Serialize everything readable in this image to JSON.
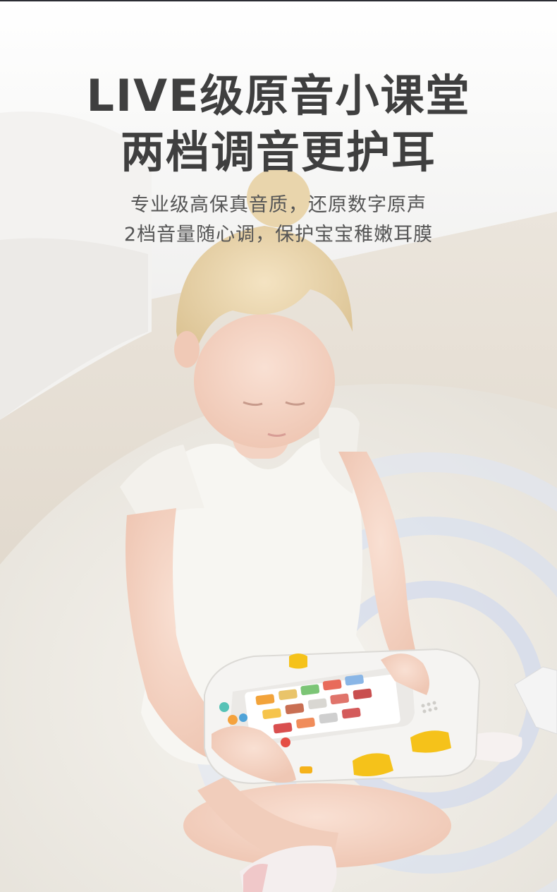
{
  "headline": {
    "line1": "LIVE级原音小课堂",
    "line2": "两档调音更护耳"
  },
  "subcopy": {
    "line1": "专业级高保真音质，还原数字原声",
    "line2": "2档音量随心调，保护宝宝稚嫩耳膜"
  },
  "colors": {
    "headline": "#3f3f3f",
    "subcopy": "#555555",
    "accent_yellow": "#f5c21a"
  }
}
